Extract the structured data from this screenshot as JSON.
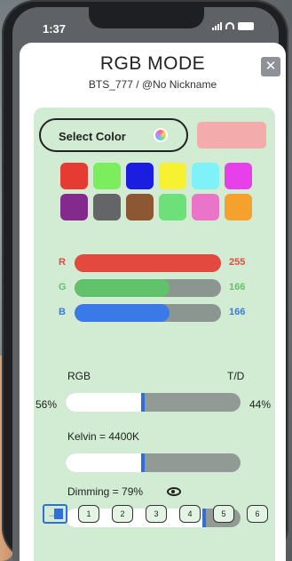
{
  "status_bar": {
    "time": "1:37"
  },
  "dialog": {
    "title": "RGB MODE",
    "subtitle": "BTS_777 / @No Nickname",
    "close_icon": "close-icon"
  },
  "select_color": {
    "label": "Select Color",
    "icon": "color-wheel-icon",
    "preview_color": "#f4abab"
  },
  "swatches": [
    "#e53b32",
    "#7ced5c",
    "#1b1ee0",
    "#f7f231",
    "#7ef2f8",
    "#e73fe9",
    "#842a8d",
    "#636566",
    "#8d5733",
    "#6ee07a",
    "#ea74c7",
    "#f5a12d"
  ],
  "rgb": [
    {
      "letter": "R",
      "value": "255",
      "level": 1.0,
      "color": "#e3493e",
      "text_color": "#e3493e"
    },
    {
      "letter": "G",
      "value": "166",
      "level": 0.651,
      "color": "#62c26b",
      "text_color": "#62c26b"
    },
    {
      "letter": "B",
      "value": "166",
      "level": 0.651,
      "color": "#3a7ae8",
      "text_color": "#3a7ae8"
    }
  ],
  "mix": {
    "left_label": "RGB",
    "right_label": "T/D",
    "left_percent": "56%",
    "right_percent": "44%",
    "level": 0.44
  },
  "kelvin": {
    "label": "Kelvin = 4400K",
    "level": 0.44
  },
  "dimming": {
    "label": "Dimming = 79%",
    "icon": "eye-icon",
    "level": 0.79
  },
  "bottom": {
    "exit_icon": "exit-icon",
    "presets": [
      "1",
      "2",
      "3",
      "4",
      "5",
      "6"
    ]
  },
  "accent": "#2f6fd8",
  "panel_color": "#d2ecd3"
}
